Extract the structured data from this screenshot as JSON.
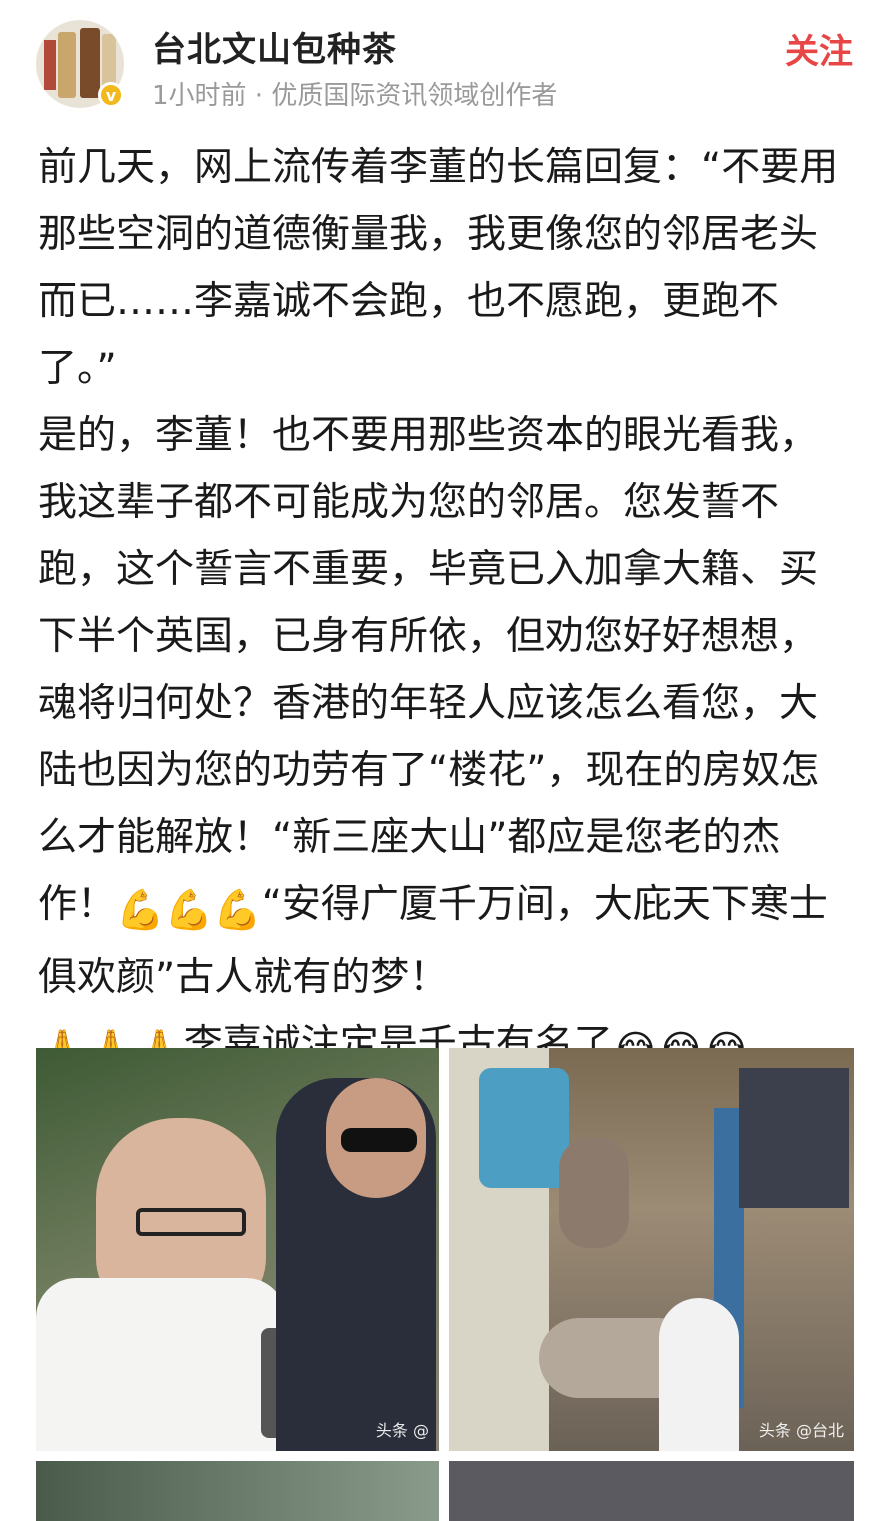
{
  "header": {
    "author_name": "台北文山包种茶",
    "meta": "1小时前 · 优质国际资讯领域创作者",
    "follow_label": "关注",
    "verified_mark": "v"
  },
  "post": {
    "paragraph1": "前几天，网上流传着李董的长篇回复：“不要用那些空洞的道德衡量我，我更像您的邻居老头而已……李嘉诚不会跑，也不愿跑，更跑不了。”",
    "paragraph2_part1": "是的，李董！也不要用那些资本的眼光看我，我这辈子都不可能成为您的邻居。您发誓不跑，这个誓言不重要，毕竟已入加拿大籍、买下半个英国，已身有所依，但劝您好好想想，魂将归何处？香港的年轻人应该怎么看您，大陆也因为您的功劳有了“楼花”，现在的房奴怎么才能解放！“新三座大山”都应是您老的杰作！",
    "flex_emoji": "💪💪💪",
    "paragraph2_part2": "“安得广厦千万间，大庇天下寒士俱欢颜”古人就有的梦！",
    "pray_emoji": "🙏🙏🙏",
    "paragraph3": "李嘉诚注定是千古有名了",
    "laugh_emoji": "😂😂😂"
  },
  "images": {
    "watermark1": "头条 @",
    "watermark2": "头条 @台北"
  }
}
